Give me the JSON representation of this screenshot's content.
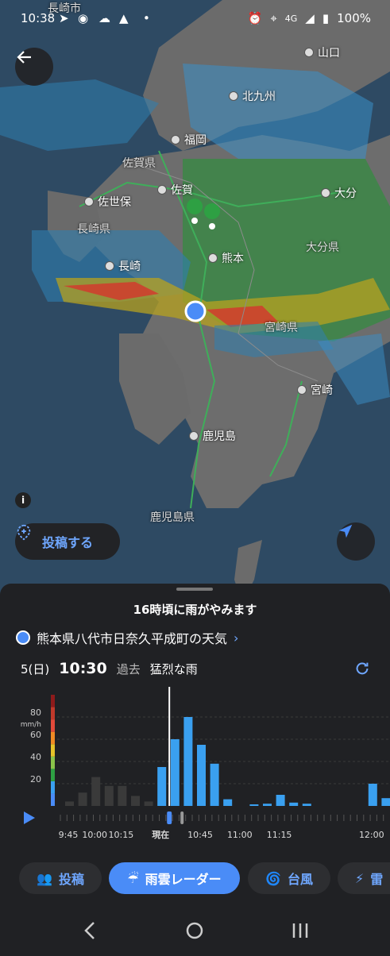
{
  "status": {
    "time": "10:38",
    "battery": "100%",
    "network": "4G"
  },
  "map": {
    "cities": [
      {
        "name": "山口"
      },
      {
        "name": "北九州"
      },
      {
        "name": "福岡"
      },
      {
        "name": "佐賀"
      },
      {
        "name": "佐世保"
      },
      {
        "name": "大分"
      },
      {
        "name": "熊本"
      },
      {
        "name": "長崎"
      },
      {
        "name": "宮崎"
      },
      {
        "name": "鹿児島"
      }
    ],
    "regions": [
      {
        "name": "佐賀県"
      },
      {
        "name": "長崎県"
      },
      {
        "name": "大分県"
      },
      {
        "name": "宮崎県"
      },
      {
        "name": "鹿児島県"
      },
      {
        "name": "長崎市"
      }
    ],
    "info_icon": "i",
    "post_label": "投稿する"
  },
  "sheet": {
    "headline": "16時頃に雨がやみます",
    "location": "熊本県八代市日奈久平成町の天気",
    "date": "5(日)",
    "time": "10:30",
    "period": "過去",
    "condition": "猛烈な雨"
  },
  "chart_data": {
    "type": "bar",
    "unit_label": "mm/h",
    "yticks": [
      20,
      40,
      60,
      80
    ],
    "ylim": [
      0,
      100
    ],
    "values": [
      4,
      12,
      26,
      18,
      18,
      9,
      4,
      35,
      60,
      80,
      55,
      38,
      6,
      0,
      1,
      2,
      10,
      3,
      2,
      0,
      0,
      0,
      0,
      20,
      7
    ],
    "now_index": 7,
    "xticks": [
      {
        "label": "9:45",
        "i": 0
      },
      {
        "label": "10:00",
        "i": 2
      },
      {
        "label": "10:15",
        "i": 4
      },
      {
        "label": "現在",
        "i": 7
      },
      {
        "label": "10:45",
        "i": 10
      },
      {
        "label": "11:00",
        "i": 13
      },
      {
        "label": "11:15",
        "i": 16
      },
      {
        "label": "12:00",
        "i": 23
      }
    ]
  },
  "tabs": [
    {
      "label": "投稿"
    },
    {
      "label": "雨雲レーダー"
    },
    {
      "label": "台風"
    },
    {
      "label": "雷"
    }
  ],
  "colors": {
    "accent": "#4a8cf7",
    "past_bar": "#3a3a3a",
    "future_bar": "#3aa0f0"
  }
}
